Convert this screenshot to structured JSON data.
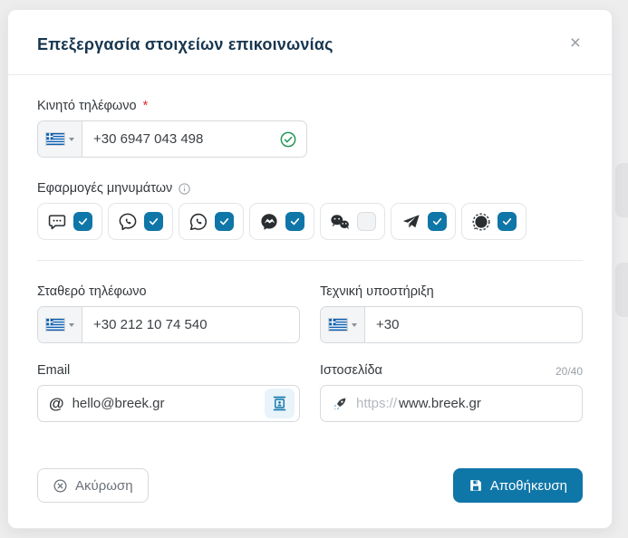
{
  "window": {
    "title": "Επεξεργασία στοιχείων επικοινωνίας",
    "close_glyph": "×"
  },
  "fields": {
    "mobile": {
      "label": "Κινητό τηλέφωνο",
      "required_mark": "*",
      "country": "GR",
      "value": "+30 6947 043 498",
      "valid": true
    },
    "apps": {
      "label": "Εφαρμογές μηνυμάτων",
      "items": [
        {
          "name": "SMS",
          "checked": true
        },
        {
          "name": "Viber",
          "checked": true
        },
        {
          "name": "WhatsApp",
          "checked": true
        },
        {
          "name": "Messenger",
          "checked": true
        },
        {
          "name": "WeChat",
          "checked": false
        },
        {
          "name": "Telegram",
          "checked": true
        },
        {
          "name": "Signal",
          "checked": true
        }
      ]
    },
    "landline": {
      "label": "Σταθερό τηλέφωνο",
      "country": "GR",
      "value": "+30 212 10 74 540"
    },
    "support": {
      "label": "Τεχνική υποστήριξη",
      "country": "GR",
      "value": "+30"
    },
    "email": {
      "label": "Email",
      "at_symbol": "@",
      "value": "hello@breek.gr"
    },
    "website": {
      "label": "Ιστοσελίδα",
      "counter": "20/40",
      "protocol_prefix": "https://",
      "value": "www.breek.gr"
    }
  },
  "buttons": {
    "cancel": "Ακύρωση",
    "save": "Αποθήκευση"
  },
  "colors": {
    "accent_blue": "#0f76a8",
    "title_navy": "#17364f",
    "success_green": "#219653",
    "required_red": "#e02b2b",
    "flag_blue": "#0d5eaf"
  }
}
